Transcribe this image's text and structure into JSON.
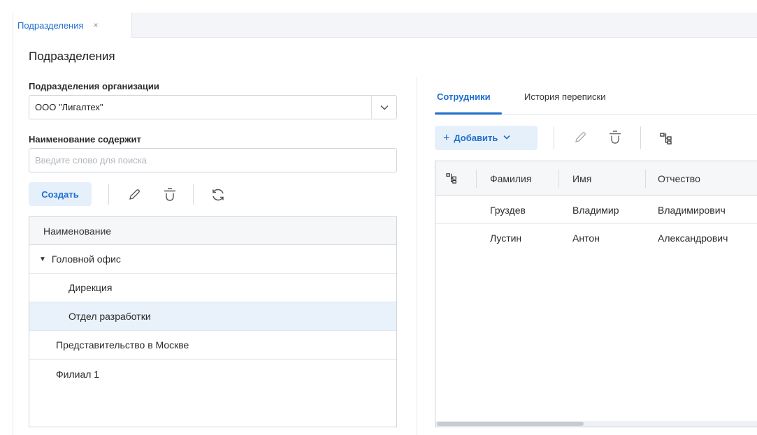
{
  "doc_tab": {
    "label": "Подразделения",
    "close": "×"
  },
  "page_title": "Подразделения",
  "left": {
    "org_label": "Подразделения организации",
    "org_value": "ООО \"Лигалтех\"",
    "name_label": "Наименование содержит",
    "search_placeholder": "Введите слово для поиска",
    "create_label": "Создать",
    "tree": {
      "header": "Наименование",
      "rows": [
        {
          "label": "Головной офис",
          "level": 0,
          "expanded": true,
          "selected": false
        },
        {
          "label": "Дирекция",
          "level": 1,
          "selected": false
        },
        {
          "label": "Отдел разработки",
          "level": 1,
          "selected": true
        },
        {
          "label": "Представительство в Москве",
          "level": 0,
          "selected": false
        },
        {
          "label": "Филиал 1",
          "level": 0,
          "selected": false
        }
      ]
    }
  },
  "right": {
    "tabs": [
      {
        "label": "Сотрудники",
        "active": true
      },
      {
        "label": "История переписки",
        "active": false
      }
    ],
    "add_label": "Добавить",
    "grid": {
      "columns": [
        "Фамилия",
        "Имя",
        "Отчество"
      ],
      "rows": [
        [
          "Груздев",
          "Владимир",
          "Владимирович"
        ],
        [
          "Лустин",
          "Антон",
          "Александрович"
        ]
      ]
    }
  },
  "colors": {
    "accent": "#1f6fce",
    "accent_bg": "#e6f0fb",
    "selected_row": "#e9f1fa"
  }
}
